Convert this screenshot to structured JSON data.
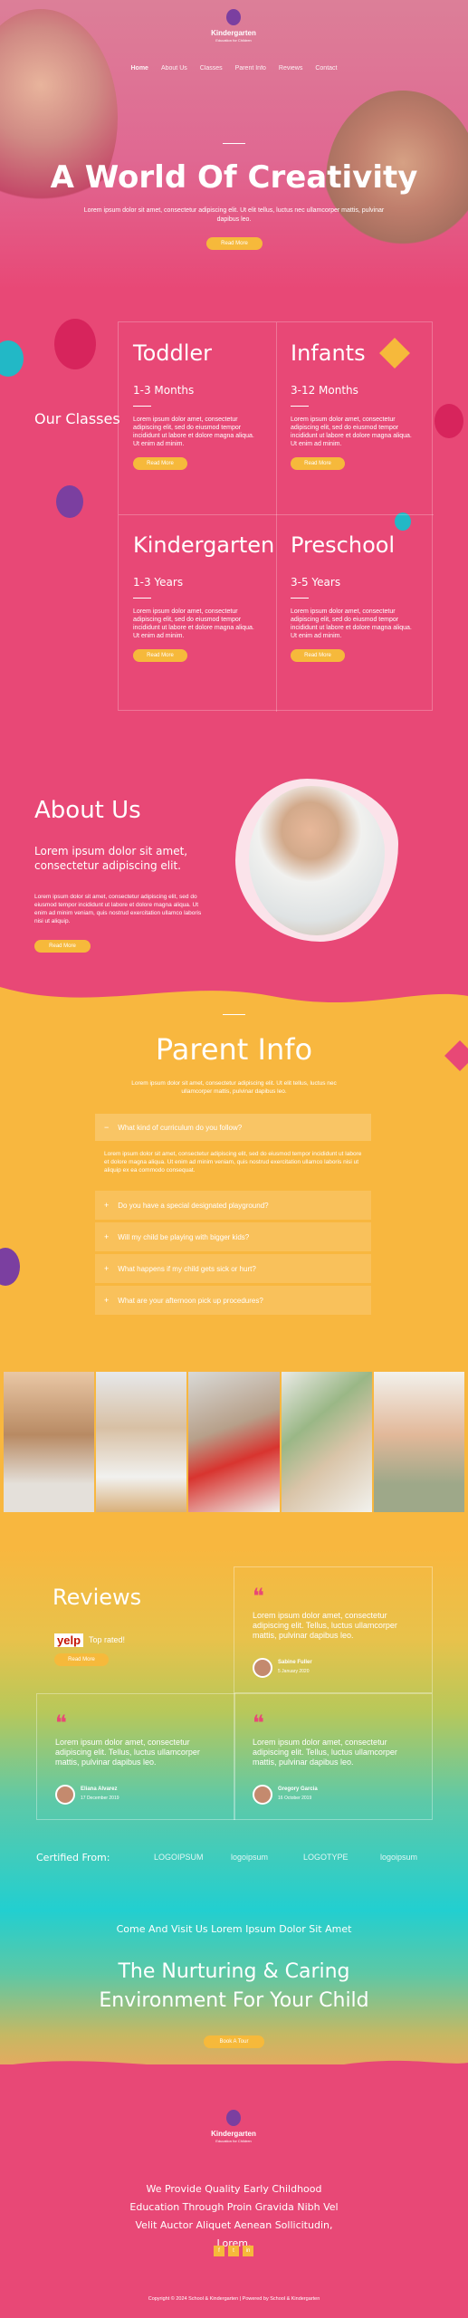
{
  "brand": {
    "name": "Kindergarten",
    "tagline": "Education for Children"
  },
  "nav": [
    "Home",
    "About Us",
    "Classes",
    "Parent Info",
    "Reviews",
    "Contact"
  ],
  "hero": {
    "title": "A World Of Creativity",
    "text": "Lorem ipsum dolor sit amet, consectetur adipiscing elit. Ut elit tellus, luctus nec ullamcorper mattis, pulvinar dapibus leo.",
    "button": "Read More"
  },
  "classes": {
    "heading": "Our Classes",
    "items": [
      {
        "name": "Toddler",
        "age": "1-3 Months",
        "text": "Lorem ipsum dolor amet, consectetur adipiscing elit, sed do eiusmod tempor incididunt ut labore et dolore magna aliqua. Ut enim ad minim.",
        "button": "Read More"
      },
      {
        "name": "Infants",
        "age": "3-12 Months",
        "text": "Lorem ipsum dolor amet, consectetur adipiscing elit, sed do eiusmod tempor incididunt ut labore et dolore magna aliqua. Ut enim ad minim.",
        "button": "Read More"
      },
      {
        "name": "Kindergarten",
        "age": "1-3 Years",
        "text": "Lorem ipsum dolor amet, consectetur adipiscing elit, sed do eiusmod tempor incididunt ut labore et dolore magna aliqua. Ut enim ad minim.",
        "button": "Read More"
      },
      {
        "name": "Preschool",
        "age": "3-5 Years",
        "text": "Lorem ipsum dolor amet, consectetur adipiscing elit, sed do eiusmod tempor incididunt ut labore et dolore magna aliqua. Ut enim ad minim.",
        "button": "Read More"
      }
    ]
  },
  "about": {
    "title": "About Us",
    "subtitle": "Lorem ipsum dolor sit amet, consectetur adipiscing elit.",
    "text": "Lorem ipsum dolor sit amet, consectetur adipiscing elit, sed do eiusmod tempor incididunt ut labore et dolore magna aliqua. Ut enim ad minim veniam, quis nostrud exercitation ullamco laboris nisi ut aliquip.",
    "button": "Read More"
  },
  "parent_info": {
    "title": "Parent Info",
    "text": "Lorem ipsum dolor sit amet, consectetur adipiscing elit. Ut elit tellus, luctus nec ullamcorper mattis, pulvinar dapibus leo.",
    "faq_open": {
      "q": "What kind of curriculum do you follow?",
      "a": "Lorem ipsum dolor sit amet, consectetur adipiscing elit, sed do eiusmod tempor incididunt ut labore et dolore magna aliqua. Ut enim ad minim veniam, quis nostrud exercitation ullamco laboris nisi ut aliquip ex ea commodo consequat."
    },
    "faq_closed": [
      "Do you have a special designated playground?",
      "Will my child be playing with bigger kids?",
      "What happens if my child gets sick or hurt?",
      "What are your afternoon pick up procedures?"
    ]
  },
  "reviews": {
    "title": "Reviews",
    "yelp": "yelp",
    "rated": "Top rated!",
    "button": "Read More",
    "items": [
      {
        "text": "Lorem ipsum dolor amet, consectetur adipiscing elit. Tellus, luctus ullamcorper mattis, pulvinar dapibus leo.",
        "name": "Sabine Fuller",
        "date": "5 January 2020"
      },
      {
        "text": "Lorem ipsum dolor amet, consectetur adipiscing elit. Tellus, luctus ullamcorper mattis, pulvinar dapibus leo.",
        "name": "Eliana Alvarez",
        "date": "17 December 2019"
      },
      {
        "text": "Lorem ipsum dolor amet, consectetur adipiscing elit. Tellus, luctus ullamcorper mattis, pulvinar dapibus leo.",
        "name": "Gregory Garcia",
        "date": "16 October 2019"
      }
    ]
  },
  "certified": {
    "label": "Certified From:",
    "logos": [
      "LOGOIPSUM",
      "logoipsum",
      "LOGOTYPE",
      "logoipsum"
    ]
  },
  "cta": {
    "small": "Come And Visit Us Lorem Ipsum Dolor Sit Amet",
    "big": "The Nurturing & Caring Environment For Your Child",
    "button": "Book A Tour"
  },
  "footer": {
    "text": "We Provide Quality Early Childhood Education Through Proin Gravida Nibh Vel Velit Auctor Aliquet Aenean Sollicitudin, Lorem.",
    "social": [
      "f",
      "t",
      "in"
    ],
    "copyright": "Copyright © 2024 School & Kindergarten | Powered by School & Kindergarten"
  },
  "colors": {
    "pink": "#e84876",
    "yellow": "#f6b93b",
    "teal": "#22cfd0",
    "purple": "#7b3fa0"
  }
}
